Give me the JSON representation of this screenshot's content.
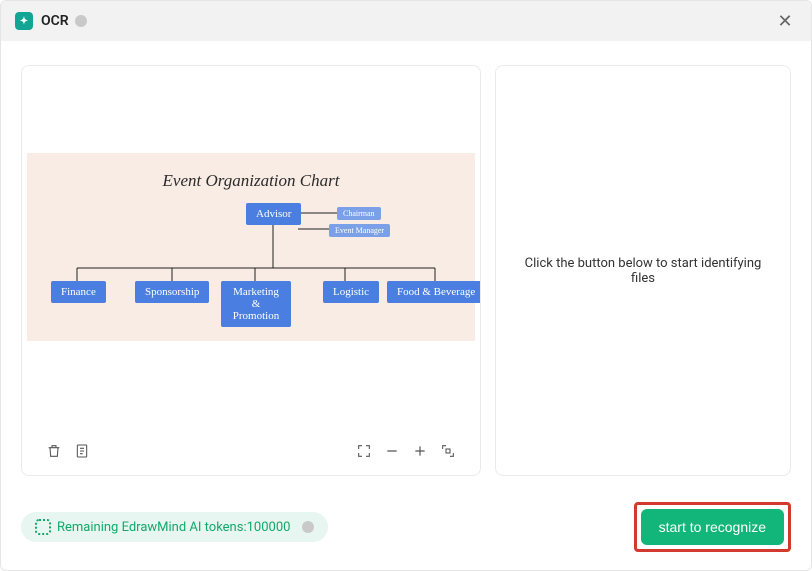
{
  "header": {
    "title": "OCR"
  },
  "preview": {
    "title": "Event Organization Chart",
    "nodes": {
      "advisor": "Advisor",
      "chairman": "Chairman",
      "event_manager": "Event Manager",
      "finance": "Finance",
      "sponsorship": "Sponsorship",
      "marketing": "Marketing & Promotion",
      "logistic": "Logistic",
      "food": "Food & Beverage"
    }
  },
  "right": {
    "placeholder": "Click the button below to start identifying files"
  },
  "footer": {
    "tokens_label": "Remaining EdrawMind AI tokens:100000",
    "recognize_label": "start to recognize"
  }
}
